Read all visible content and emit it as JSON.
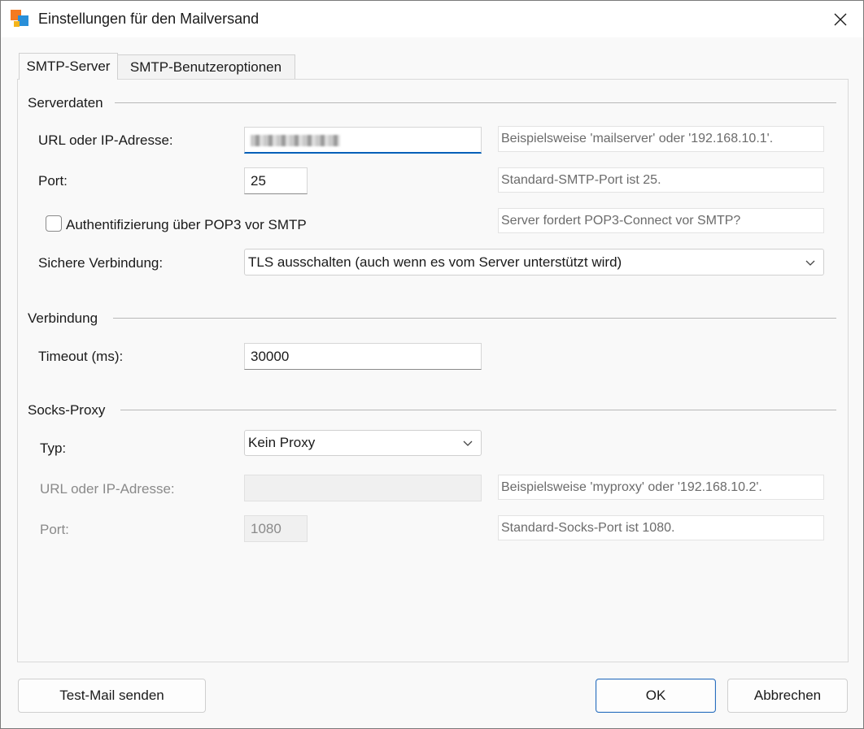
{
  "window": {
    "title": "Einstellungen für den Mailversand"
  },
  "tabs": [
    {
      "label": "SMTP-Server",
      "active": true
    },
    {
      "label": "SMTP-Benutzeroptionen",
      "active": false
    }
  ],
  "serverdaten": {
    "group_title": "Serverdaten",
    "url_label": "URL oder IP-Adresse:",
    "url_value": "",
    "url_hint": "Beispielsweise 'mailserver' oder '192.168.10.1'.",
    "port_label": "Port:",
    "port_value": "25",
    "port_hint": "Standard-SMTP-Port ist 25.",
    "auth_label": "Authentifizierung über POP3 vor SMTP",
    "auth_checked": false,
    "auth_hint": "Server fordert POP3-Connect vor SMTP?",
    "secure_label": "Sichere Verbindung:",
    "secure_value": "TLS ausschalten (auch wenn es vom Server unterstützt wird)"
  },
  "verbindung": {
    "group_title": "Verbindung",
    "timeout_label": "Timeout (ms):",
    "timeout_value": "30000"
  },
  "proxy": {
    "group_title": "Socks-Proxy",
    "type_label": "Typ:",
    "type_value": "Kein Proxy",
    "url_label": "URL oder IP-Adresse:",
    "url_value": "",
    "url_hint": "Beispielsweise 'myproxy' oder '192.168.10.2'.",
    "port_label": "Port:",
    "port_value": "1080",
    "port_hint": "Standard-Socks-Port ist 1080."
  },
  "buttons": {
    "test_mail": "Test-Mail senden",
    "ok": "OK",
    "cancel": "Abbrechen"
  },
  "icons": {
    "close": "close-icon",
    "chevron": "chevron-down-icon",
    "app": "app-icon"
  }
}
